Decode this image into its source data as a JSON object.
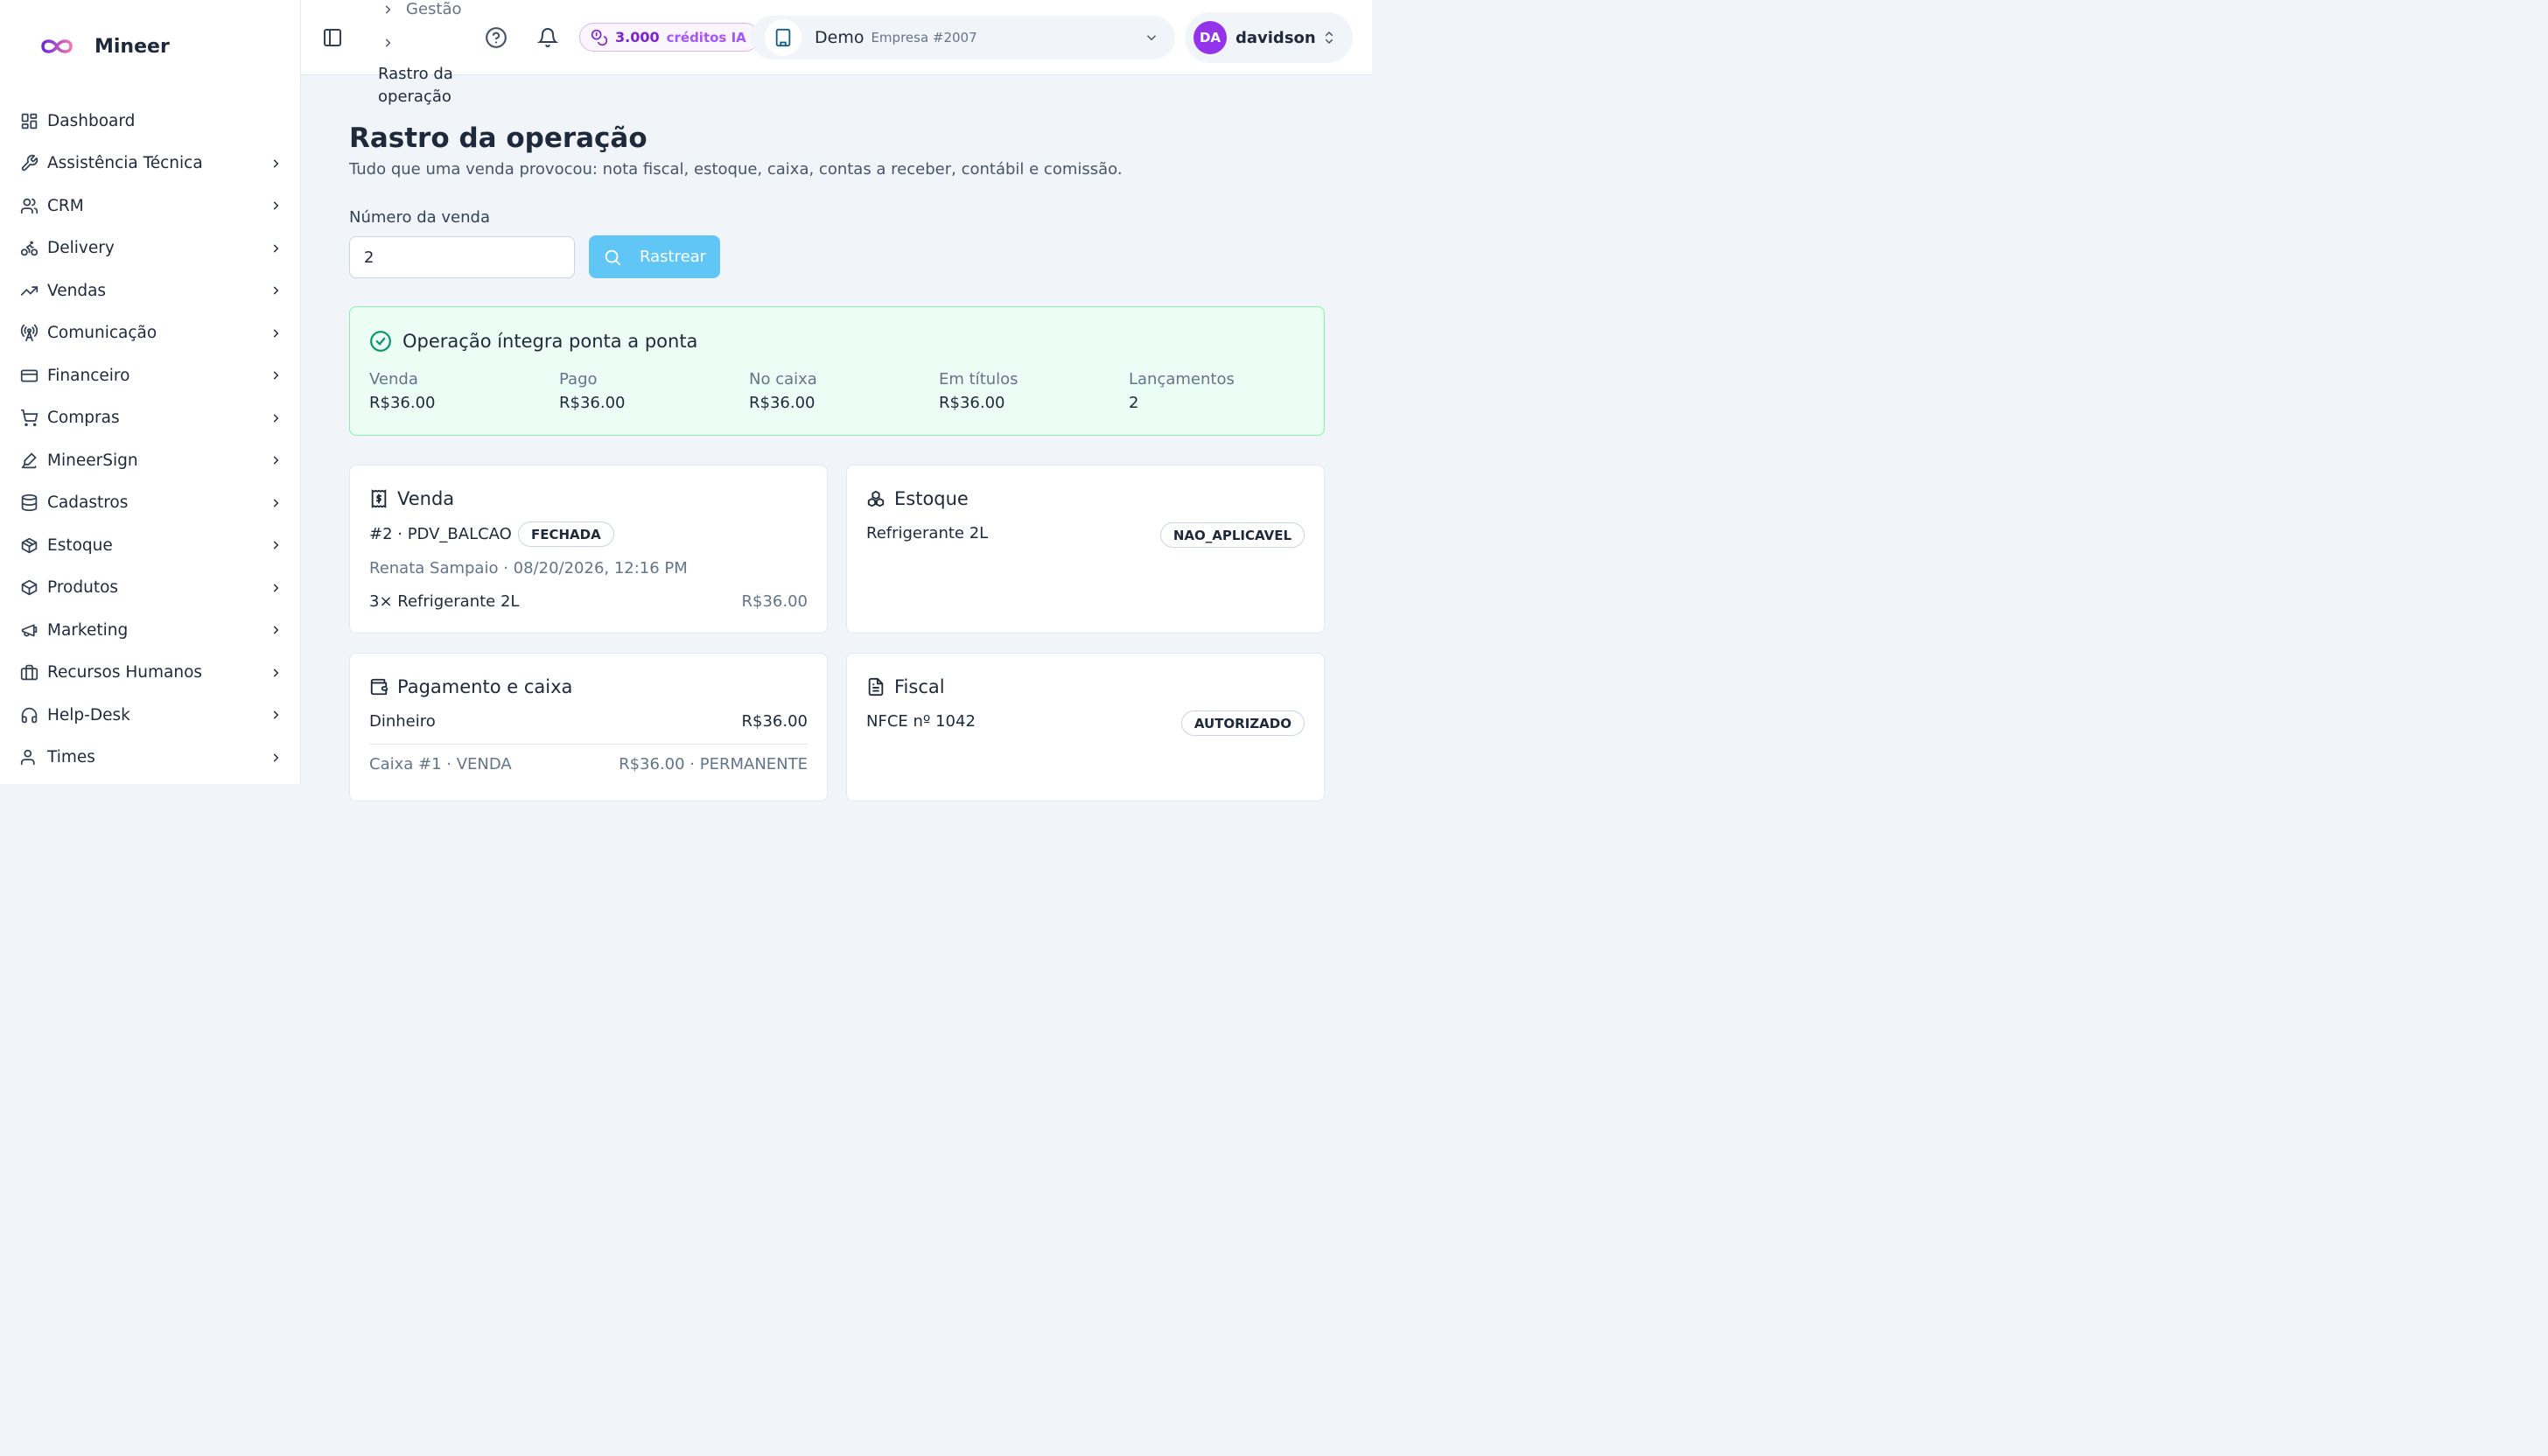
{
  "brand": {
    "name": "Mineer"
  },
  "sidebar": {
    "items": [
      {
        "label": "Dashboard",
        "icon": "dashboard-icon",
        "has_children": false
      },
      {
        "label": "Assistência Técnica",
        "icon": "wrench-icon",
        "has_children": true
      },
      {
        "label": "CRM",
        "icon": "users-icon",
        "has_children": true
      },
      {
        "label": "Delivery",
        "icon": "bike-icon",
        "has_children": true
      },
      {
        "label": "Vendas",
        "icon": "trending-up-icon",
        "has_children": true
      },
      {
        "label": "Comunicação",
        "icon": "radio-tower-icon",
        "has_children": true
      },
      {
        "label": "Financeiro",
        "icon": "credit-card-icon",
        "has_children": true
      },
      {
        "label": "Compras",
        "icon": "cart-icon",
        "has_children": true
      },
      {
        "label": "MineerSign",
        "icon": "signature-icon",
        "has_children": true
      },
      {
        "label": "Cadastros",
        "icon": "database-icon",
        "has_children": true
      },
      {
        "label": "Estoque",
        "icon": "package-icon",
        "has_children": true
      },
      {
        "label": "Produtos",
        "icon": "box-icon",
        "has_children": true
      },
      {
        "label": "Marketing",
        "icon": "megaphone-icon",
        "has_children": true
      },
      {
        "label": "Recursos Humanos",
        "icon": "briefcase-icon",
        "has_children": true
      },
      {
        "label": "Help-Desk",
        "icon": "headphones-icon",
        "has_children": true
      },
      {
        "label": "Times",
        "icon": "team-icon",
        "has_children": true
      }
    ]
  },
  "topbar": {
    "breadcrumb": {
      "parent": "Gestão",
      "current": "Rastro da operação"
    },
    "credits": {
      "amount": "3.000",
      "label": "créditos IA"
    },
    "company": {
      "name": "Demo",
      "sub": "Empresa #2007"
    },
    "user": {
      "initials": "DA",
      "name": "davidson"
    }
  },
  "main": {
    "title": "Rastro da operação",
    "subtitle": "Tudo que uma venda provocou: nota fiscal, estoque, caixa, contas a receber, contábil e comissão.",
    "search": {
      "label": "Número da venda",
      "value": "2",
      "button": "Rastrear"
    },
    "integrity": {
      "title": "Operação íntegra ponta a ponta",
      "metrics": [
        {
          "label": "Venda",
          "value": "R$36.00"
        },
        {
          "label": "Pago",
          "value": "R$36.00"
        },
        {
          "label": "No caixa",
          "value": "R$36.00"
        },
        {
          "label": "Em títulos",
          "value": "R$36.00"
        },
        {
          "label": "Lançamentos",
          "value": "2"
        }
      ]
    },
    "venda": {
      "title": "Venda",
      "summary": "#2 · PDV_BALCAO ·",
      "status": "FECHADA",
      "meta": "Renata Sampaio · 08/20/2026, 12:16 PM",
      "item": "3× Refrigerante 2L",
      "item_total": "R$36.00"
    },
    "estoque": {
      "title": "Estoque",
      "item": "Refrigerante 2L",
      "status": "NAO_APLICAVEL"
    },
    "pagamento": {
      "title": "Pagamento e caixa",
      "method": "Dinheiro",
      "method_total": "R$36.00",
      "cash": "Caixa #1 · VENDA",
      "cash_total": "R$36.00 · PERMANENTE"
    },
    "fiscal": {
      "title": "Fiscal",
      "doc": "NFCE nº 1042",
      "status": "AUTORIZADO"
    }
  }
}
